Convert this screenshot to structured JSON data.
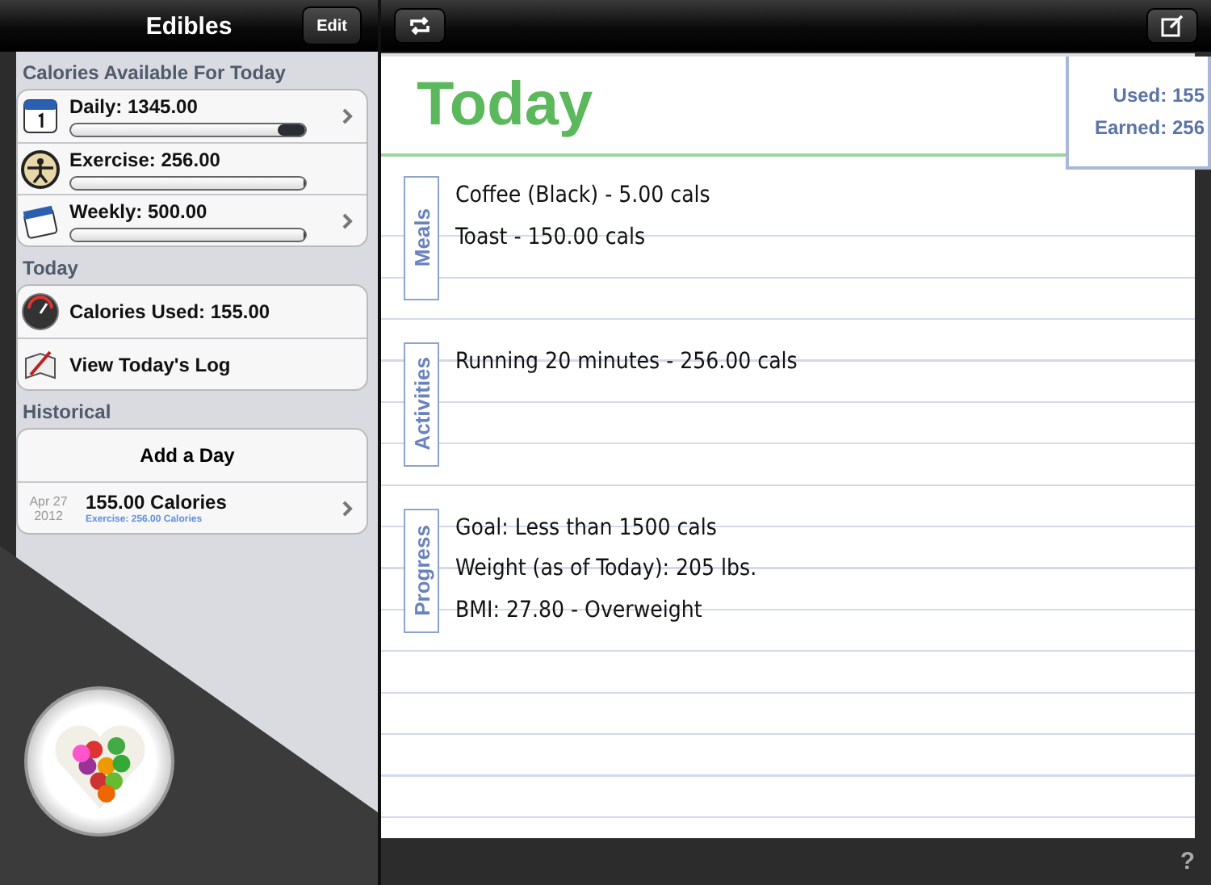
{
  "sidebar": {
    "title": "Edibles",
    "edit_button": "Edit",
    "sections": [
      {
        "heading": "Calories Available For Today",
        "kind": "meters",
        "items": [
          {
            "label": "Daily: 1345.00",
            "level": 0.12,
            "chevron": true
          },
          {
            "label": "Exercise: 256.00",
            "level": 0,
            "chevron": false
          },
          {
            "label": "Weekly: 500.00",
            "level": 0,
            "chevron": true
          }
        ]
      },
      {
        "heading": "Today",
        "kind": "links",
        "items": [
          {
            "label": "Calories Used: 155.00"
          },
          {
            "label": "View Today's Log"
          }
        ]
      },
      {
        "heading": "Historical",
        "kind": "history",
        "add_label": "Add a Day",
        "items": [
          {
            "month_day": "Apr 27",
            "year": "2012",
            "label": "155.00 Calories",
            "detail": "Exercise: 256.00 Calories"
          }
        ]
      }
    ]
  },
  "log": {
    "title": "Today",
    "summary": [
      "Used: 155",
      "Earned: 256"
    ],
    "sections": [
      {
        "label": "Meals",
        "entries": [
          "Coffee (Black) - 5.00 cals",
          "Toast - 150.00 cals"
        ]
      },
      {
        "label": "Activities",
        "entries": [
          "Running 20 minutes - 256.00 cals"
        ]
      },
      {
        "label": "Progress",
        "entries": [
          "Goal: Less than 1500 cals",
          "Weight (as of Today): 205 lbs.",
          "BMI: 27.80 - Overweight"
        ]
      }
    ],
    "help": "?"
  }
}
